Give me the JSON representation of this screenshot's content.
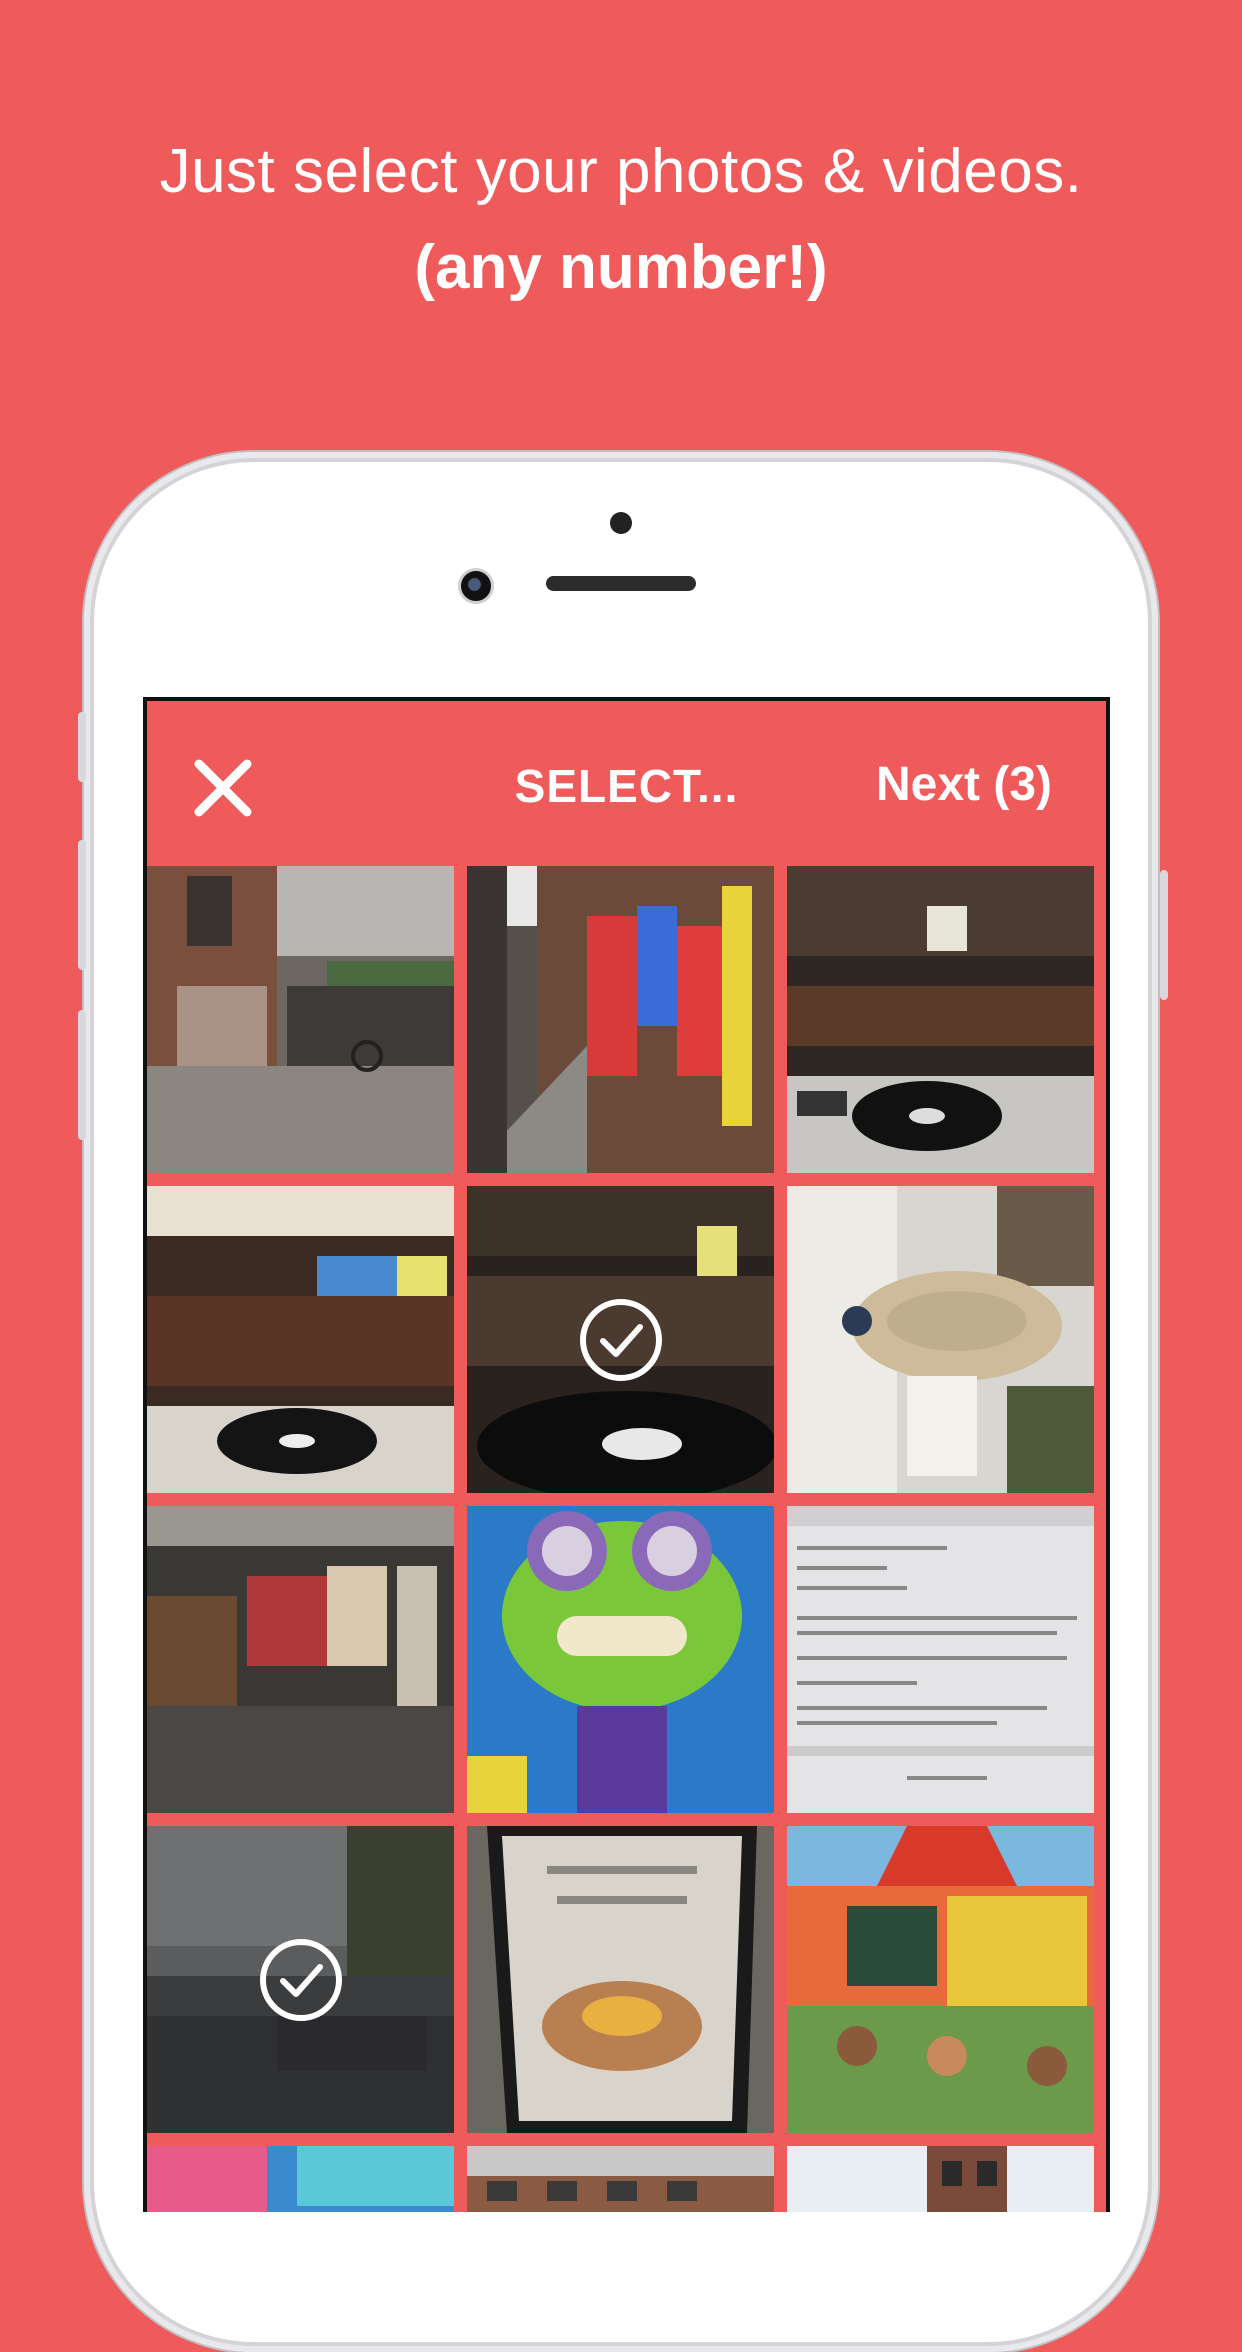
{
  "headline": {
    "line1": "Just select your photos & videos.",
    "line2": "(any number!)"
  },
  "topbar": {
    "title": "SELECT...",
    "next_label": "Next (3)",
    "close_icon": "close-icon"
  },
  "grid": {
    "photos": [
      {
        "name": "alley-courtyard-bikes",
        "selected": false
      },
      {
        "name": "graffiti-alley",
        "selected": false
      },
      {
        "name": "record-shop-turntable",
        "selected": false
      },
      {
        "name": "record-shop-interior",
        "selected": false
      },
      {
        "name": "turntable-closeup",
        "selected": true
      },
      {
        "name": "millennium-falcon-model",
        "selected": false
      },
      {
        "name": "arcade-passage",
        "selected": false
      },
      {
        "name": "frog-graffiti",
        "selected": false
      },
      {
        "name": "screen-text-photo",
        "selected": false
      },
      {
        "name": "canal-boats",
        "selected": true
      },
      {
        "name": "food-poster",
        "selected": false
      },
      {
        "name": "school-mural",
        "selected": false
      },
      {
        "name": "mural-partial",
        "selected": false
      },
      {
        "name": "buildings-partial",
        "selected": false
      },
      {
        "name": "tower-partial",
        "selected": false
      }
    ]
  },
  "colors": {
    "background": "#EF5A5A",
    "text": "#FFFFFF"
  }
}
